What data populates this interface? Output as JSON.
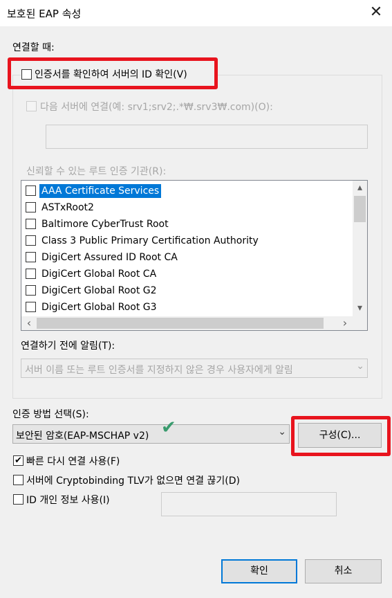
{
  "window": {
    "title": "보호된 EAP 속성",
    "close_glyph": "✕"
  },
  "connect_section": {
    "heading": "연결할 때:"
  },
  "verify_cert": {
    "label": "인증서를 확인하여 서버의 ID 확인(V)",
    "checked": false
  },
  "connect_servers": {
    "label": "다음 서버에 연결(예: srv1;srv2;.*₩.srv3₩.com)(O):",
    "value": ""
  },
  "trusted_ca": {
    "label": "신뢰할 수 있는 루트 인증 기관(R):",
    "items": [
      {
        "name": "AAA Certificate Services",
        "selected": true
      },
      {
        "name": "ASTxRoot2"
      },
      {
        "name": "Baltimore CyberTrust Root"
      },
      {
        "name": "Class 3 Public Primary Certification Authority"
      },
      {
        "name": "DigiCert Assured ID Root CA"
      },
      {
        "name": "DigiCert Global Root CA"
      },
      {
        "name": "DigiCert Global Root G2"
      },
      {
        "name": "DigiCert Global Root G3"
      }
    ]
  },
  "notify": {
    "label": "연결하기 전에 알림(T):",
    "value": "서버 이름 또는 루트 인증서를 지정하지 않은 경우 사용자에게 알림"
  },
  "auth_method": {
    "label": "인증 방법 선택(S):",
    "value": "보안된 암호(EAP-MSCHAP v2)",
    "configure_label": "구성(C)..."
  },
  "options": [
    {
      "label": "빠른 다시 연결 사용(F)",
      "checked": true
    },
    {
      "label": "서버에 Cryptobinding TLV가 없으면 연결 끊기(D)",
      "checked": false
    },
    {
      "label": "ID 개인 정보 사용(I)",
      "checked": false
    }
  ],
  "identity_privacy_value": "",
  "buttons": {
    "ok": "확인",
    "cancel": "취소"
  },
  "colors": {
    "highlight": "#e8141e",
    "selection": "#0078d7",
    "check_mark": "#3a9b6e"
  },
  "icons": {
    "check": "✔",
    "dropdown": "⌄",
    "scroll_up": "▴",
    "scroll_down": "▾",
    "scroll_left": "‹",
    "scroll_right": "›"
  }
}
